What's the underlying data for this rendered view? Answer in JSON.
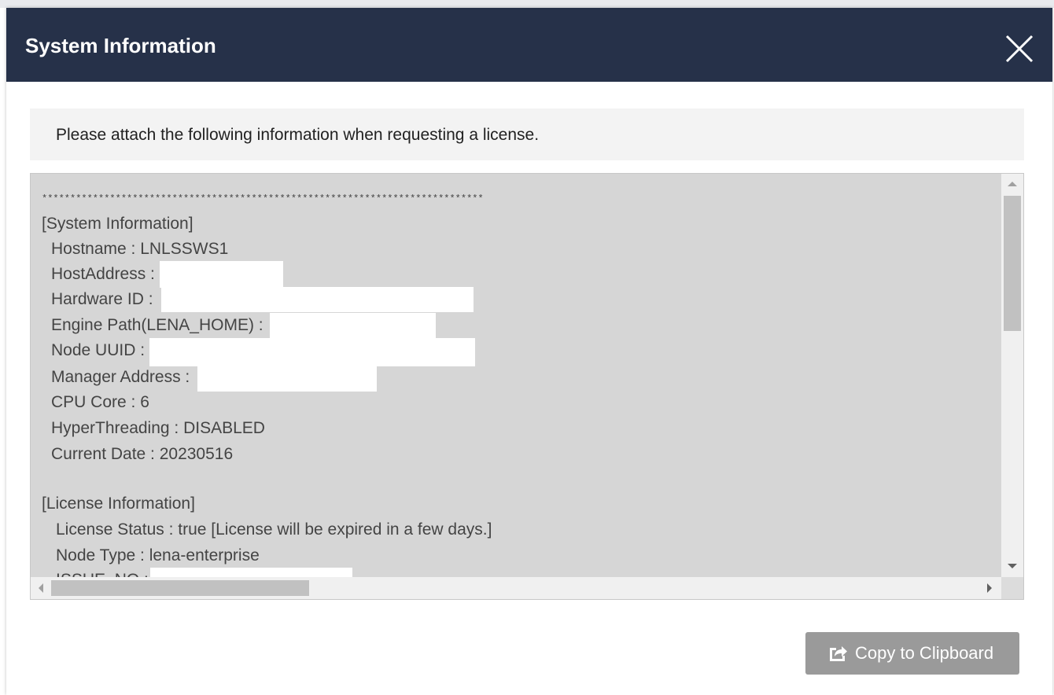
{
  "dialog": {
    "title": "System Information",
    "close_icon": "close-icon",
    "notice": "Please attach the following information when requesting a license."
  },
  "info": {
    "separator": "******************************************************************************",
    "system_section": "[System Information]",
    "hostname": "Hostname : LNLSSWS1",
    "host_address_label": "HostAddress :",
    "hardware_id_label": "Hardware ID :",
    "engine_path_label": "Engine Path(LENA_HOME) :",
    "node_uuid_label": "Node UUID :",
    "manager_address_label": "Manager Address :",
    "cpu_core": "CPU Core : 6",
    "hyperthreading": "HyperThreading : DISABLED",
    "current_date": "Current Date : 20230516",
    "license_section": "[License Information]",
    "license_status": "License Status : true [License will be expired in a few days.]",
    "node_type": "Node Type : lena-enterprise",
    "issue_no_label": "ISSUE_NO :"
  },
  "actions": {
    "copy_label": "Copy to Clipboard",
    "copy_icon": "share-icon"
  },
  "colors": {
    "header_bg": "#263149",
    "info_bg": "#d6d6d6",
    "button_bg": "#9a9a9a"
  }
}
